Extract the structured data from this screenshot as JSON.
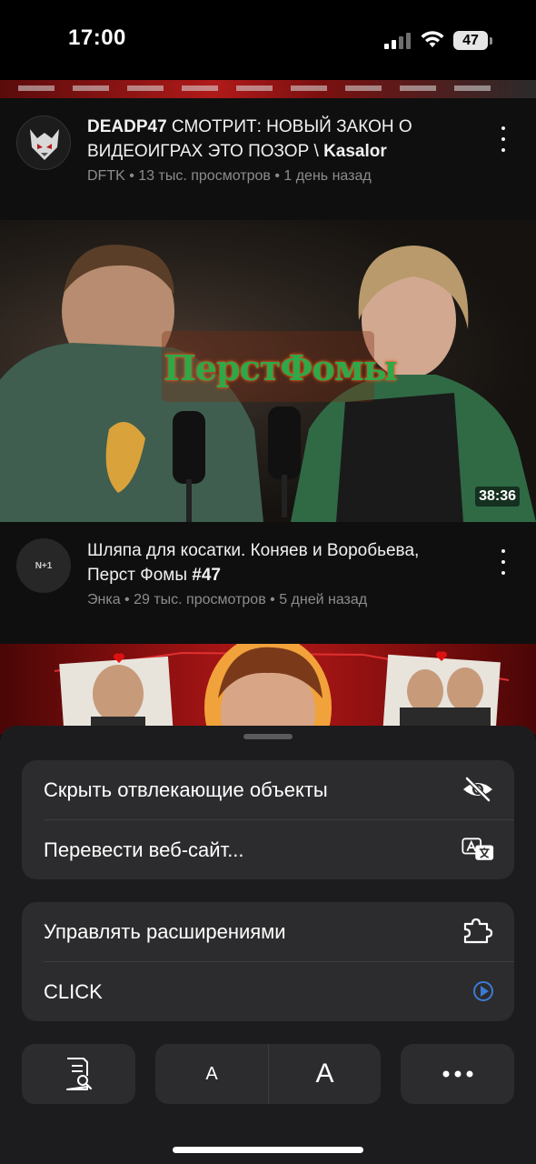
{
  "status": {
    "time": "17:00",
    "battery": "47"
  },
  "feed": [
    {
      "title_bold": "DEADP47",
      "title_rest": " СМОТРИТ: НОВЫЙ ЗАКОН О ВИДЕОИГРАХ ЭТО ПОЗОР \\ ",
      "title_bold_end": "Kasalor",
      "channel": "DFTK",
      "views": "13 тыс. просмотров",
      "age": "1 день назад"
    },
    {
      "thumbnail_logo_text": "ПерстФомы",
      "duration": "38:36",
      "avatar_text": "N+1",
      "title": "Шляпа для косатки. Коняев и Воробьева, Перст Фомы ",
      "title_tag": "#47",
      "channel": "Энка",
      "views": "29 тыс. просмотров",
      "age": "5 дней назад"
    }
  ],
  "menu": {
    "group1": [
      {
        "label": "Скрыть отвлекающие объекты",
        "icon": "eye-slash-icon"
      },
      {
        "label": "Перевести веб-сайт...",
        "icon": "translate-icon"
      }
    ],
    "group2": [
      {
        "label": "Управлять расширениями",
        "icon": "extension-icon"
      },
      {
        "label": "CLICK",
        "icon": "click-extension-icon"
      }
    ]
  },
  "toolbar": {
    "page_search_icon": "page-search-icon",
    "font_smaller": "A",
    "font_larger": "A",
    "more_icon": "ellipsis-icon"
  },
  "colors": {
    "accent_blue": "#3a7bd5",
    "sheet_bg": "#1c1c1e",
    "group_bg": "#2c2c2e"
  }
}
